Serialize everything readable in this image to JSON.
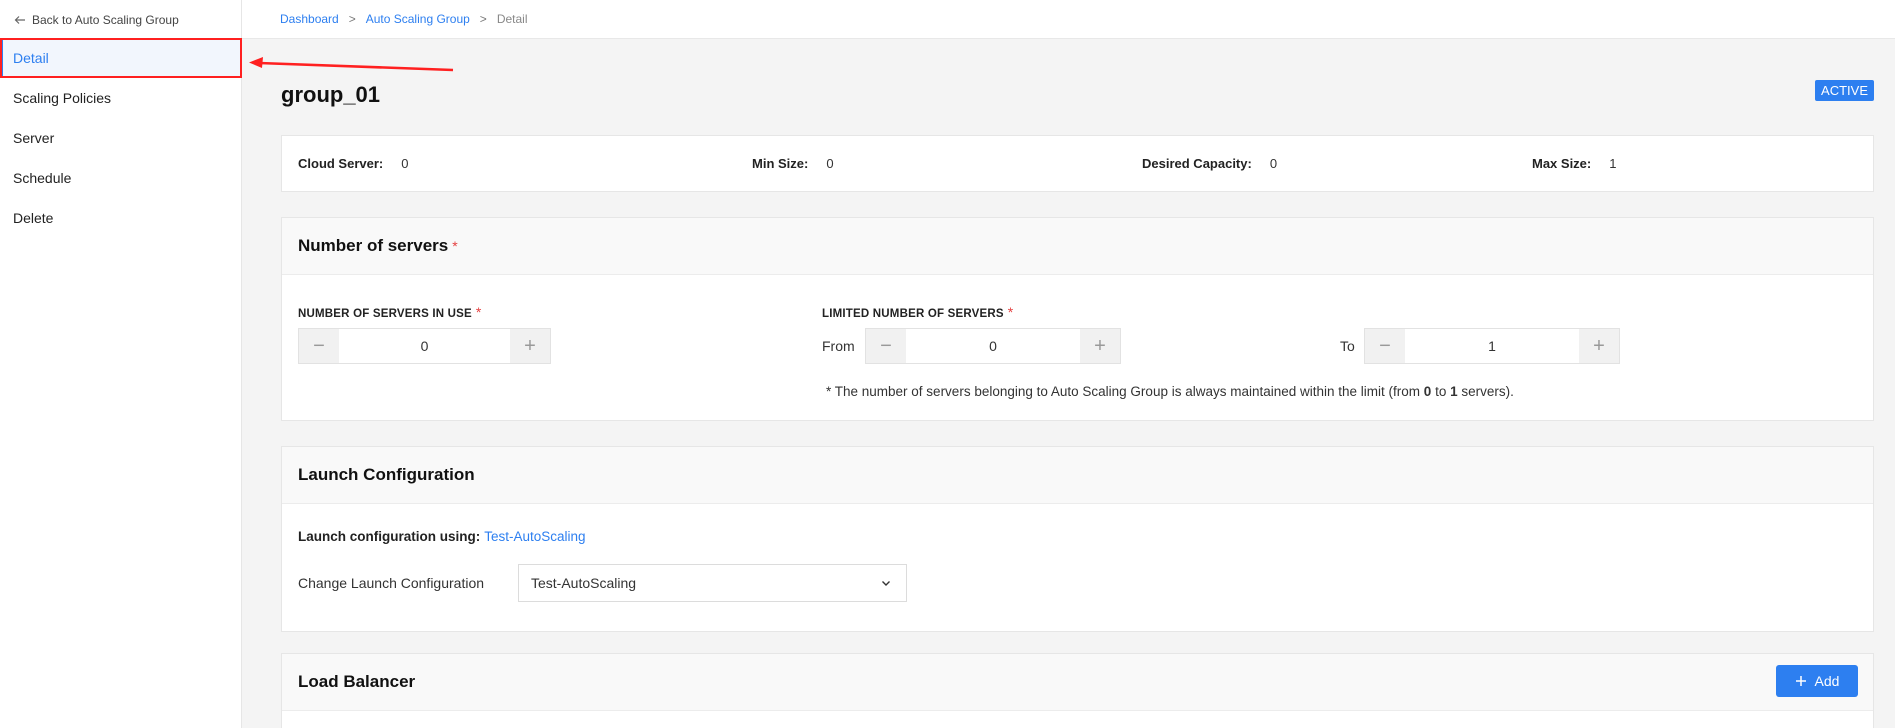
{
  "sidebar": {
    "back_label": "Back to Auto Scaling Group",
    "items": [
      {
        "label": "Detail"
      },
      {
        "label": "Scaling Policies"
      },
      {
        "label": "Server"
      },
      {
        "label": "Schedule"
      },
      {
        "label": "Delete"
      }
    ]
  },
  "breadcrumb": {
    "items": [
      "Dashboard",
      "Auto Scaling Group"
    ],
    "separator": ">",
    "current": "Detail"
  },
  "page": {
    "title": "group_01",
    "status": "ACTIVE"
  },
  "summary": {
    "cloud_server_label": "Cloud Server:",
    "cloud_server_value": "0",
    "min_size_label": "Min Size:",
    "min_size_value": "0",
    "desired_label": "Desired Capacity:",
    "desired_value": "0",
    "max_size_label": "Max Size:",
    "max_size_value": "1"
  },
  "servers": {
    "title": "Number of servers",
    "required_mark": "*",
    "in_use_label": "NUMBER OF SERVERS IN USE",
    "in_use_value": "0",
    "limited_label": "LIMITED NUMBER OF SERVERS",
    "from_label": "From",
    "from_value": "0",
    "to_label": "To",
    "to_value": "1",
    "note_prefix": "* The number of servers belonging to Auto Scaling Group is always maintained within the limit (from ",
    "note_from": "0",
    "note_mid": " to ",
    "note_to": "1",
    "note_suffix": " servers)."
  },
  "launch": {
    "title": "Launch Configuration",
    "using_label": "Launch configuration using:",
    "using_link": "Test-AutoScaling",
    "change_label": "Change Launch Configuration",
    "selected": "Test-AutoScaling"
  },
  "load_balancer": {
    "title": "Load Balancer",
    "add_label": "Add"
  },
  "colors": {
    "accent": "#2d7ff0",
    "annotation": "#ff2020",
    "required": "#e54040"
  }
}
